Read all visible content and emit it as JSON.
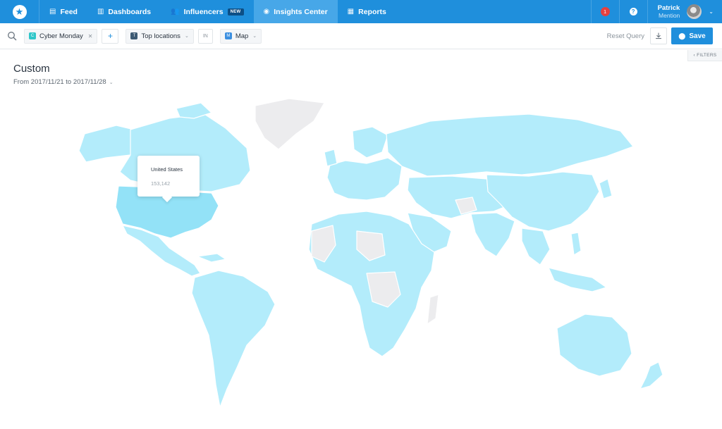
{
  "nav": {
    "logo_icon": "star-icon",
    "items": [
      {
        "label": "Feed",
        "icon": "feed-icon"
      },
      {
        "label": "Dashboards",
        "icon": "bar-chart-icon"
      },
      {
        "label": "Influencers",
        "icon": "people-icon",
        "badge": "NEW"
      },
      {
        "label": "Insights Center",
        "icon": "compass-icon",
        "active": true
      },
      {
        "label": "Reports",
        "icon": "grid-icon"
      }
    ],
    "notifications_count": "1",
    "help_icon": "question-icon",
    "user": {
      "name": "Patrick",
      "org": "Mention"
    }
  },
  "query": {
    "search_icon": "search-icon",
    "alert_chip": {
      "tag": "C",
      "label": "Cyber Monday"
    },
    "add_label": "+",
    "metric_chip": {
      "tag": "T",
      "label": "Top locations"
    },
    "in_label": "IN",
    "view_chip": {
      "tag": "M",
      "label": "Map"
    },
    "reset_label": "Reset Query",
    "save_label": "Save"
  },
  "filters_label": "‹ FILTERS",
  "page": {
    "title": "Custom",
    "date_range": "From 2017/11/21 to 2017/11/28"
  },
  "map": {
    "colors": {
      "base": "#b3ecfb",
      "highlight": "#93e2f7",
      "no_data": "#ececee"
    },
    "tooltip": {
      "country": "United States",
      "value": "153,142"
    }
  }
}
